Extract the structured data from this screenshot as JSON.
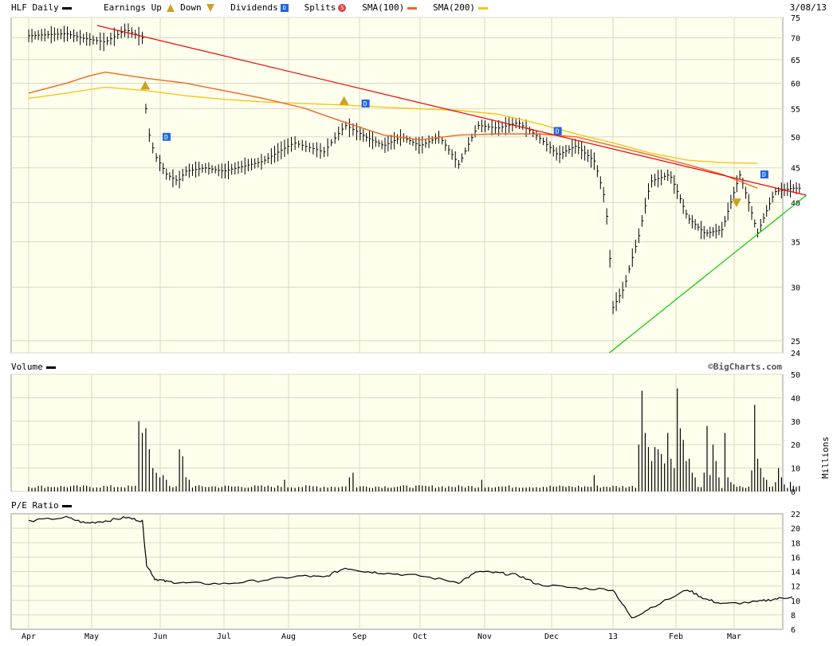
{
  "header": {
    "symbol_label": "HLF Daily",
    "earnings_label": "Earnings Up",
    "down_label": "Down",
    "dividends_label": "Dividends",
    "splits_label": "Splits",
    "sma100_label": "SMA(100)",
    "sma200_label": "SMA(200)",
    "date": "3/08/13"
  },
  "volume_label": "Volume",
  "volume_units": "Millions",
  "pe_label": "P/E Ratio",
  "credit": "©BigCharts.com",
  "colors": {
    "background": "#ffffee",
    "grid": "#d8d8c0",
    "bars": "#000000",
    "sma100": "#f26522",
    "sma200": "#f5c518",
    "trend_down": "#ee0000",
    "trend_up": "#00cc00",
    "dividend": "#2266dd",
    "earnings": "#c9a227",
    "split": "#dd4444"
  },
  "chart_data": [
    {
      "type": "ohlc",
      "name": "price",
      "y_scale": "log",
      "ylim": [
        24,
        75
      ],
      "y_ticks": [
        75,
        70,
        65,
        60,
        55,
        50,
        45,
        40,
        35,
        30,
        25,
        24
      ],
      "x_ticks": [
        "Apr",
        "May",
        "Jun",
        "Jul",
        "Aug",
        "Sep",
        "Oct",
        "Nov",
        "Dec",
        "13",
        "Feb",
        "Mar"
      ],
      "grid": true,
      "series": [
        {
          "name": "SMA(100)",
          "values": [
            [
              0,
              58
            ],
            [
              1,
              60
            ],
            [
              1.6,
              61.5
            ],
            [
              2,
              62.3
            ],
            [
              3,
              61
            ],
            [
              4,
              60
            ],
            [
              5,
              58.5
            ],
            [
              6,
              57
            ],
            [
              7,
              55.2
            ],
            [
              8,
              52.5
            ],
            [
              9,
              50.3
            ],
            [
              10,
              49.5
            ],
            [
              11,
              50.3
            ],
            [
              12,
              50.5
            ],
            [
              13,
              50.5
            ],
            [
              14,
              50
            ],
            [
              15,
              48.5
            ],
            [
              16,
              47
            ],
            [
              17,
              45.5
            ],
            [
              18,
              44
            ],
            [
              19,
              42
            ]
          ]
        },
        {
          "name": "SMA(200)",
          "values": [
            [
              0,
              57
            ],
            [
              1,
              58
            ],
            [
              2,
              59.2
            ],
            [
              3,
              58.5
            ],
            [
              4,
              57.5
            ],
            [
              5,
              56.8
            ],
            [
              6,
              56.3
            ],
            [
              7,
              56
            ],
            [
              8,
              55.7
            ],
            [
              9,
              55.3
            ],
            [
              10,
              55
            ],
            [
              11,
              54.7
            ],
            [
              12,
              54
            ],
            [
              13,
              52.3
            ],
            [
              14,
              50.5
            ],
            [
              15,
              49
            ],
            [
              16,
              47.3
            ],
            [
              17,
              46.2
            ],
            [
              18,
              45.8
            ],
            [
              19,
              45.7
            ]
          ]
        },
        {
          "name": "Downtrend",
          "values": [
            [
              1.8,
              73
            ],
            [
              20.4,
              41
            ]
          ]
        },
        {
          "name": "Uptrend",
          "values": [
            [
              14.9,
              24
            ],
            [
              20.4,
              41
            ]
          ]
        }
      ],
      "ohlc_anchors": [
        [
          0,
          70.5
        ],
        [
          1,
          71
        ],
        [
          1.4,
          70
        ],
        [
          2,
          69
        ],
        [
          2.5,
          72
        ],
        [
          2.7,
          71
        ],
        [
          2.9,
          70
        ],
        [
          3,
          52
        ],
        [
          3.2,
          47
        ],
        [
          3.5,
          44
        ],
        [
          3.8,
          43
        ],
        [
          4,
          44.5
        ],
        [
          4.5,
          45
        ],
        [
          5,
          44.5
        ],
        [
          6,
          46
        ],
        [
          6.8,
          49
        ],
        [
          7.5,
          47.5
        ],
        [
          8,
          52
        ],
        [
          8.5,
          50
        ],
        [
          9,
          48.5
        ],
        [
          9.5,
          50
        ],
        [
          10,
          48.5
        ],
        [
          10.5,
          50
        ],
        [
          11,
          45.5
        ],
        [
          11.5,
          52
        ],
        [
          12,
          51.5
        ],
        [
          12.5,
          52.5
        ],
        [
          13,
          50
        ],
        [
          13.5,
          47
        ],
        [
          14,
          48.5
        ],
        [
          14.5,
          46
        ],
        [
          14.8,
          40
        ],
        [
          15,
          28
        ],
        [
          15.3,
          30
        ],
        [
          15.7,
          36
        ],
        [
          16,
          43
        ],
        [
          16.5,
          44
        ],
        [
          17,
          38
        ],
        [
          17.5,
          36
        ],
        [
          18,
          36.5
        ],
        [
          18.5,
          44
        ],
        [
          19,
          36
        ],
        [
          19.5,
          41.5
        ],
        [
          20,
          42
        ]
      ],
      "ohlc_bar_count": 238,
      "markers": [
        {
          "type": "earnings-up",
          "x": 2.97,
          "y": 59.5
        },
        {
          "type": "earnings-up",
          "x": 7.97,
          "y": 56.5
        },
        {
          "type": "earnings-down",
          "x": 18.4,
          "y": 40
        },
        {
          "type": "dividend",
          "x": 3.5,
          "y": 50
        },
        {
          "type": "dividend",
          "x": 8.5,
          "y": 56
        },
        {
          "type": "dividend",
          "x": 13.5,
          "y": 51
        },
        {
          "type": "dividend",
          "x": 19.2,
          "y": 44
        }
      ]
    },
    {
      "type": "bar",
      "name": "volume",
      "ylim": [
        0,
        50
      ],
      "y_ticks": [
        50,
        40,
        30,
        20,
        10,
        0
      ],
      "ylabel": "Millions",
      "grid": true,
      "bar_count": 238,
      "baseline": 1.5,
      "spikes": [
        [
          33,
          30
        ],
        [
          34,
          25
        ],
        [
          35,
          27
        ],
        [
          36,
          18
        ],
        [
          37,
          10
        ],
        [
          38,
          8
        ],
        [
          39,
          6
        ],
        [
          40,
          7
        ],
        [
          41,
          5
        ],
        [
          45,
          18
        ],
        [
          46,
          15
        ],
        [
          47,
          6
        ],
        [
          48,
          5
        ],
        [
          77,
          5
        ],
        [
          95,
          6
        ],
        [
          96,
          8
        ],
        [
          136,
          5
        ],
        [
          170,
          7
        ],
        [
          184,
          20
        ],
        [
          185,
          43
        ],
        [
          186,
          25
        ],
        [
          187,
          19
        ],
        [
          188,
          13
        ],
        [
          189,
          19
        ],
        [
          190,
          18
        ],
        [
          191,
          16
        ],
        [
          192,
          12
        ],
        [
          193,
          25
        ],
        [
          194,
          14
        ],
        [
          195,
          10
        ],
        [
          196,
          44
        ],
        [
          197,
          27
        ],
        [
          198,
          22
        ],
        [
          199,
          13
        ],
        [
          200,
          14
        ],
        [
          201,
          8
        ],
        [
          202,
          6
        ],
        [
          205,
          8
        ],
        [
          206,
          28
        ],
        [
          207,
          7
        ],
        [
          208,
          20
        ],
        [
          209,
          13
        ],
        [
          210,
          6
        ],
        [
          212,
          25
        ],
        [
          213,
          6
        ],
        [
          214,
          4
        ],
        [
          215,
          3
        ],
        [
          221,
          9
        ],
        [
          222,
          37
        ],
        [
          223,
          14
        ],
        [
          224,
          10
        ],
        [
          225,
          6
        ],
        [
          226,
          5
        ],
        [
          229,
          4
        ],
        [
          230,
          10
        ],
        [
          231,
          6
        ],
        [
          232,
          3
        ],
        [
          234,
          4
        ]
      ]
    },
    {
      "type": "line",
      "name": "pe",
      "ylim": [
        6,
        22
      ],
      "y_ticks": [
        22,
        20,
        18,
        16,
        14,
        12,
        10,
        8,
        6
      ],
      "grid": true,
      "values": [
        [
          0,
          21
        ],
        [
          1,
          21.5
        ],
        [
          1.5,
          20.7
        ],
        [
          2,
          21
        ],
        [
          2.5,
          21.5
        ],
        [
          2.9,
          21
        ],
        [
          3,
          15
        ],
        [
          3.2,
          13
        ],
        [
          3.5,
          12.6
        ],
        [
          4,
          12.4
        ],
        [
          5,
          12.3
        ],
        [
          6,
          12.8
        ],
        [
          7,
          13.4
        ],
        [
          7.5,
          13.2
        ],
        [
          8,
          14.5
        ],
        [
          8.5,
          14
        ],
        [
          9,
          13.8
        ],
        [
          10,
          13.4
        ],
        [
          11,
          12.5
        ],
        [
          11.5,
          14
        ],
        [
          12,
          13.8
        ],
        [
          12.5,
          13.5
        ],
        [
          13,
          12.2
        ],
        [
          14,
          11.7
        ],
        [
          15,
          11.5
        ],
        [
          15.5,
          7.5
        ],
        [
          16,
          9
        ],
        [
          17,
          11.5
        ],
        [
          17.5,
          10.2
        ],
        [
          18,
          9.5
        ],
        [
          19,
          9.8
        ],
        [
          19.5,
          10.2
        ],
        [
          20,
          10.5
        ]
      ]
    }
  ]
}
